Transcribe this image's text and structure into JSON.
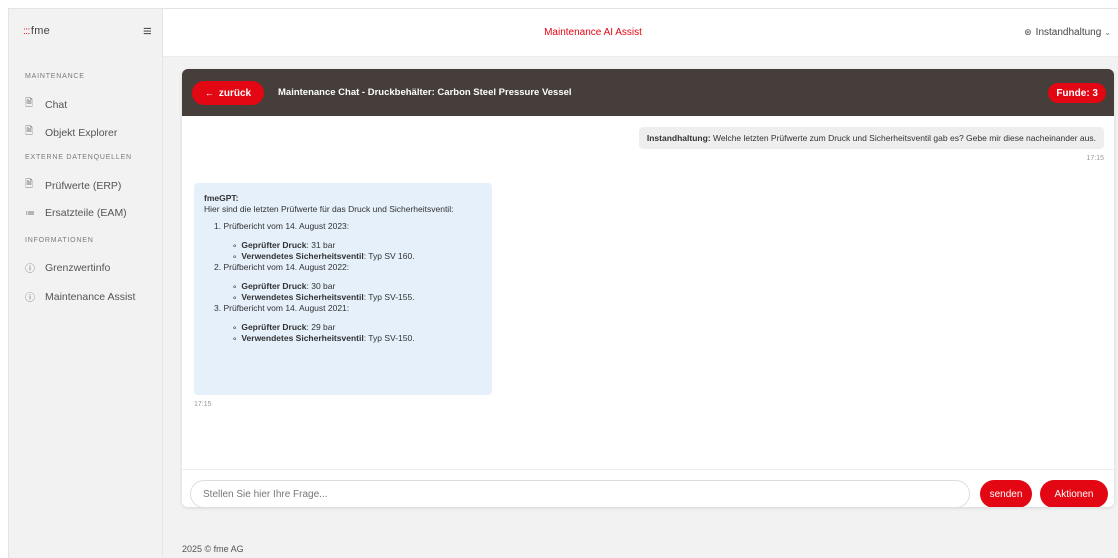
{
  "brand": {
    "dots": ":::",
    "name": "fme"
  },
  "sidebar": {
    "sections": {
      "maintenance": "MAINTENANCE",
      "external": "EXTERNE DATENQUELLEN",
      "info": "INFORMATIONEN"
    },
    "items": [
      {
        "label": "Chat",
        "icon": "document-icon"
      },
      {
        "label": "Objekt Explorer",
        "icon": "document-icon"
      },
      {
        "label": "Prüfwerte (ERP)",
        "icon": "document-chart-icon"
      },
      {
        "label": "Ersatzteile (EAM)",
        "icon": "list-icon"
      },
      {
        "label": "Grenzwertinfo",
        "icon": "info-icon"
      },
      {
        "label": "Maintenance Assist",
        "icon": "info-icon"
      }
    ]
  },
  "header": {
    "title": "Maintenance AI Assist",
    "user": "Instandhaltung"
  },
  "chat": {
    "back_label": "zurück",
    "title": "Maintenance Chat - Druckbehälter: Carbon Steel Pressure Vessel",
    "funde": "Funde: 3",
    "user_message": {
      "author": "Instandhaltung:",
      "text": " Welche letzten Prüfwerte zum Druck und Sicherheitsventil gab es? Gebe mir diese nacheinander aus.",
      "time": "17:15"
    },
    "bot_message": {
      "author": "fmeGPT:",
      "intro": "Hier sind die letzten Prüfwerte für das Druck  und Sicherheitsventil:",
      "reports": [
        {
          "title": "1. Prüfbericht vom 14. August 2023:",
          "pressure_label": "Geprüfter Druck",
          "pressure": ": 31 bar",
          "valve_label": "Verwendetes Sicherheitsventil",
          "valve": ": Typ SV 160."
        },
        {
          "title": "2. Prüfbericht vom 14. August 2022:",
          "pressure_label": "Geprüfter Druck",
          "pressure": ": 30 bar",
          "valve_label": "Verwendetes Sicherheitsventil",
          "valve": ": Typ SV-155."
        },
        {
          "title": "3. Prüfbericht vom 14. August 2021:",
          "pressure_label": "Geprüfter Druck",
          "pressure": ": 29 bar",
          "valve_label": "Verwendetes Sicherheitsventil",
          "valve": ": Typ SV-150."
        }
      ],
      "time": "17:15"
    },
    "input_placeholder": "Stellen Sie hier Ihre Frage...",
    "send_label": "senden",
    "actions_label": "Aktionen"
  },
  "footer": "2025 © fme AG",
  "colors": {
    "accent": "#e30613",
    "header_bar": "#453e3a",
    "bot_bubble": "#e5f0fb"
  }
}
